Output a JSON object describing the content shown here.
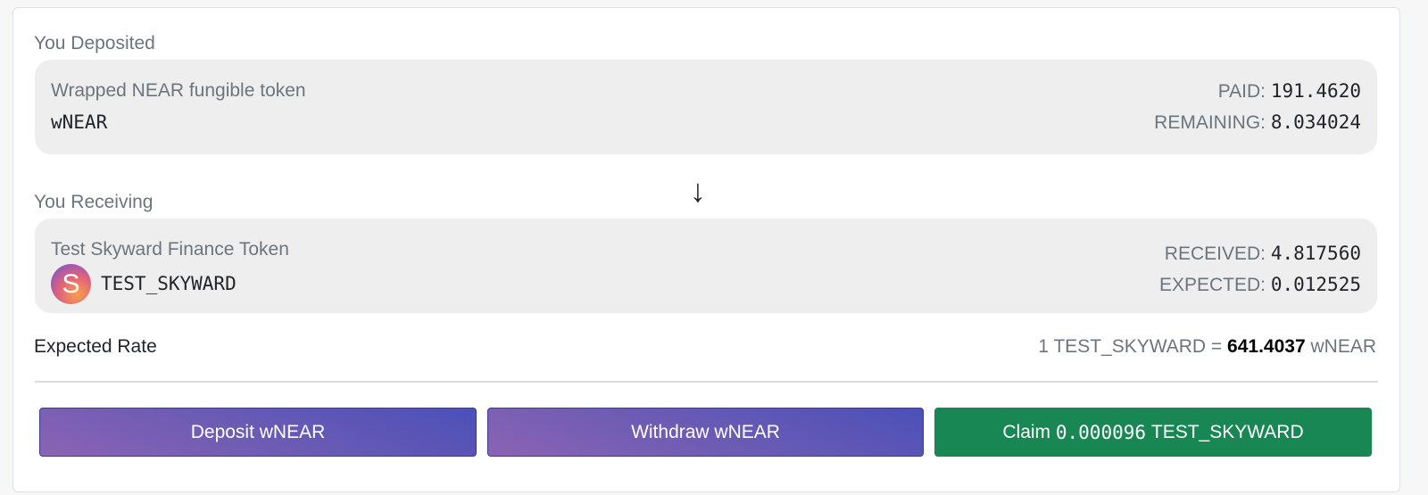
{
  "deposited": {
    "section_label": "You Deposited",
    "token_name": "Wrapped NEAR fungible token",
    "token_symbol": "wNEAR",
    "paid_label": "PAID:",
    "paid_value": "191.4620",
    "remaining_label": "REMAINING:",
    "remaining_value": "8.034024"
  },
  "arrow_icon": "arrow-down-icon",
  "receiving": {
    "section_label": "You Receiving",
    "token_name": "Test Skyward Finance Token",
    "token_symbol": "TEST_SKYWARD",
    "avatar_letter": "S",
    "received_label": "RECEIVED:",
    "received_value": "4.817560",
    "expected_label": "EXPECTED:",
    "expected_value": "0.012525"
  },
  "rate": {
    "label": "Expected Rate",
    "prefix": "1 TEST_SKYWARD =",
    "value": "641.4037",
    "suffix": "wNEAR"
  },
  "actions": {
    "deposit_label": "Deposit wNEAR",
    "withdraw_label": "Withdraw wNEAR",
    "claim_prefix": "Claim",
    "claim_amount": "0.000096",
    "claim_suffix": "TEST_SKYWARD"
  },
  "colors": {
    "claim_button": "#198754",
    "primary_gradient_start": "#8b63b3",
    "primary_gradient_end": "#4b50b8",
    "token_box_bg": "#eeeeee"
  }
}
